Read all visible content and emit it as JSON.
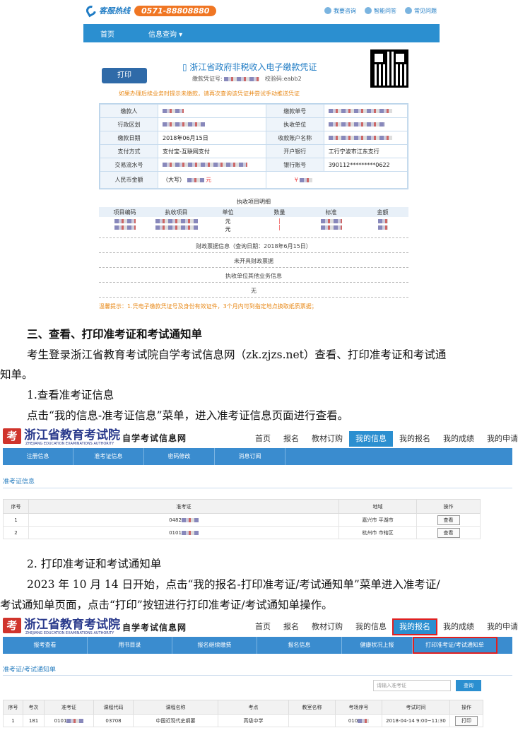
{
  "shot1": {
    "hotline_label": "客服热线",
    "phone": "0571-88808880",
    "links": [
      "我要咨询",
      "智能问答",
      "常见问题"
    ],
    "nav": [
      "首页",
      "信息查询 ▾"
    ],
    "print_label": "打印",
    "voucher_title": "浙江省政府非税收入电子缴款凭证",
    "voucher_sub_a": "缴款凭证号:",
    "voucher_sub_b": "校验码:eabb2",
    "note": "如果办理后续业务时提示未缴款，请再次查询该凭证并尝试手动推送凭证",
    "rows": [
      {
        "k1": "缴款人",
        "k2": "缴款单号"
      },
      {
        "k1": "行政区划",
        "k2": "执收单位"
      },
      {
        "k1": "缴款日期",
        "v1": "2018年06月15日",
        "k2": "收款账户名称"
      },
      {
        "k1": "支付方式",
        "v1": "支付宝-互联网支付",
        "k2": "开户银行",
        "v2": "工行宁波市江东支行"
      },
      {
        "k1": "交易流水号",
        "k2": "银行账号",
        "v2": "390112*********0622"
      },
      {
        "k1": "人民币金额",
        "v1": "（大写）",
        "v1b": "元",
        "v2": "¥"
      }
    ],
    "detail_head": "执收项目明细",
    "detail_cols": [
      "项目编码",
      "执收项目",
      "单位",
      "数量",
      "标准",
      "金额"
    ],
    "unit": "元",
    "line1": "财政票据信息（查询日期：2018年6月15日）",
    "line2": "未开具财政票据",
    "line3": "执收单位其他业务信息",
    "line4": "无",
    "tip": "温馨提示：1.凭电子缴款凭证号及身份有效证件，3个月内可到指定地点换取纸质票据；"
  },
  "text": {
    "h3": "三、查看、打印准考证和考试通知单",
    "p1a": "考生登录浙江省教育考试院自学考试信息网（zk.zjzs.net）查看、打印准考证和考试通",
    "p1b": "知单。",
    "s1": "1.查看准考证信息",
    "p2": "点击“我的信息-准考证信息”菜单，进入准考证信息页面进行查看。",
    "s2": "2. 打印准考证和考试通知单",
    "p3a": "2023 年 10 月 14 日开始，点击“我的报名-打印准考证/考试通知单”菜单进入准考证/",
    "p3b": "考试通知单页面，点击“打印”按钮进行打印准考证/考试通知单操作。"
  },
  "site": {
    "logo_mark": "考",
    "name": "浙江省教育考试院",
    "name_en": "ZHEJIANG EDUCATION EXAMINATIONS AUTHORITY",
    "sub": "自学考试信息网",
    "nav": [
      "首页",
      "报名",
      "教材订购",
      "我的信息",
      "我的报名",
      "我的成绩",
      "我的申请"
    ]
  },
  "shot2": {
    "tabs": [
      "注册信息",
      "准考证信息",
      "密码修改",
      "消息订阅"
    ],
    "section": "准考证信息",
    "cols": [
      "序号",
      "准考证",
      "地域",
      "操作"
    ],
    "rows": [
      {
        "no": "1",
        "id": "0482",
        "region": "嘉兴市 平湖市",
        "op": "查看"
      },
      {
        "no": "2",
        "id": "0101",
        "region": "杭州市 市辖区",
        "op": "查看"
      }
    ]
  },
  "shot3": {
    "tabs": [
      "报考查看",
      "用书目录",
      "报名继续缴费",
      "报名信息",
      "健康状况上报",
      "打印准考证/考试通知单"
    ],
    "section": "准考证/考试通知单",
    "search_placeholder": "请输入准考证",
    "search_label": "查询",
    "cols": [
      "序号",
      "考次",
      "准考证",
      "课程代码",
      "课程名称",
      "考点",
      "教室名称",
      "考场序号",
      "考试时间",
      "操作"
    ],
    "row": {
      "no": "1",
      "term": "181",
      "id": "0101",
      "code": "03708",
      "course": "中国近现代史纲要",
      "site": "高级中学",
      "room": "",
      "seat": "010",
      "time": "2018-04-14 9:00~11:30",
      "op": "打印"
    }
  }
}
